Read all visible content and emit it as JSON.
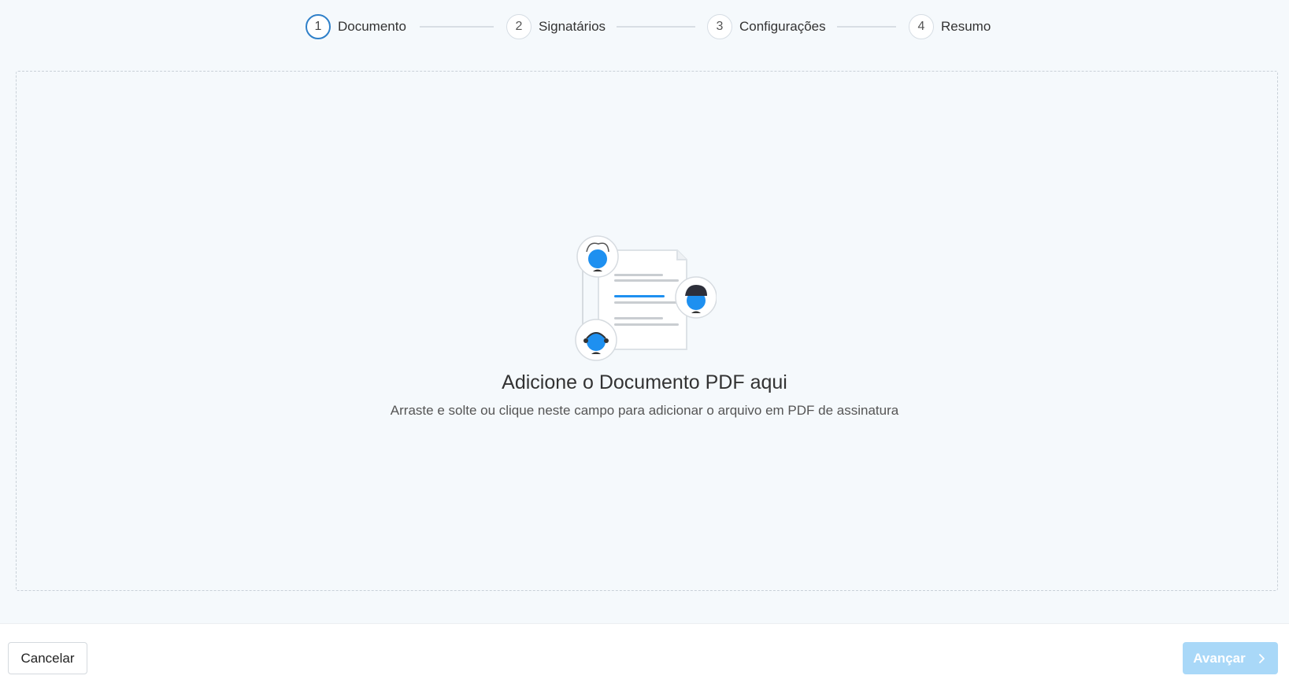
{
  "stepper": {
    "steps": [
      {
        "number": "1",
        "label": "Documento",
        "active": true
      },
      {
        "number": "2",
        "label": "Signatários",
        "active": false
      },
      {
        "number": "3",
        "label": "Configurações",
        "active": false
      },
      {
        "number": "4",
        "label": "Resumo",
        "active": false
      }
    ]
  },
  "dropzone": {
    "title": "Adicione o Documento PDF aqui",
    "subtitle": "Arraste e solte ou clique neste campo para adicionar o arquivo em PDF de assinatura",
    "illustration_icon": "document-signers-illustration"
  },
  "footer": {
    "cancel_label": "Cancelar",
    "next_label": "Avançar",
    "next_icon": "chevron-right-icon"
  },
  "colors": {
    "accent": "#2f80c9",
    "next_button_disabled": "#a9d8f8",
    "page_background": "#f5f9fc",
    "avatar_face": "#1e90f0"
  }
}
